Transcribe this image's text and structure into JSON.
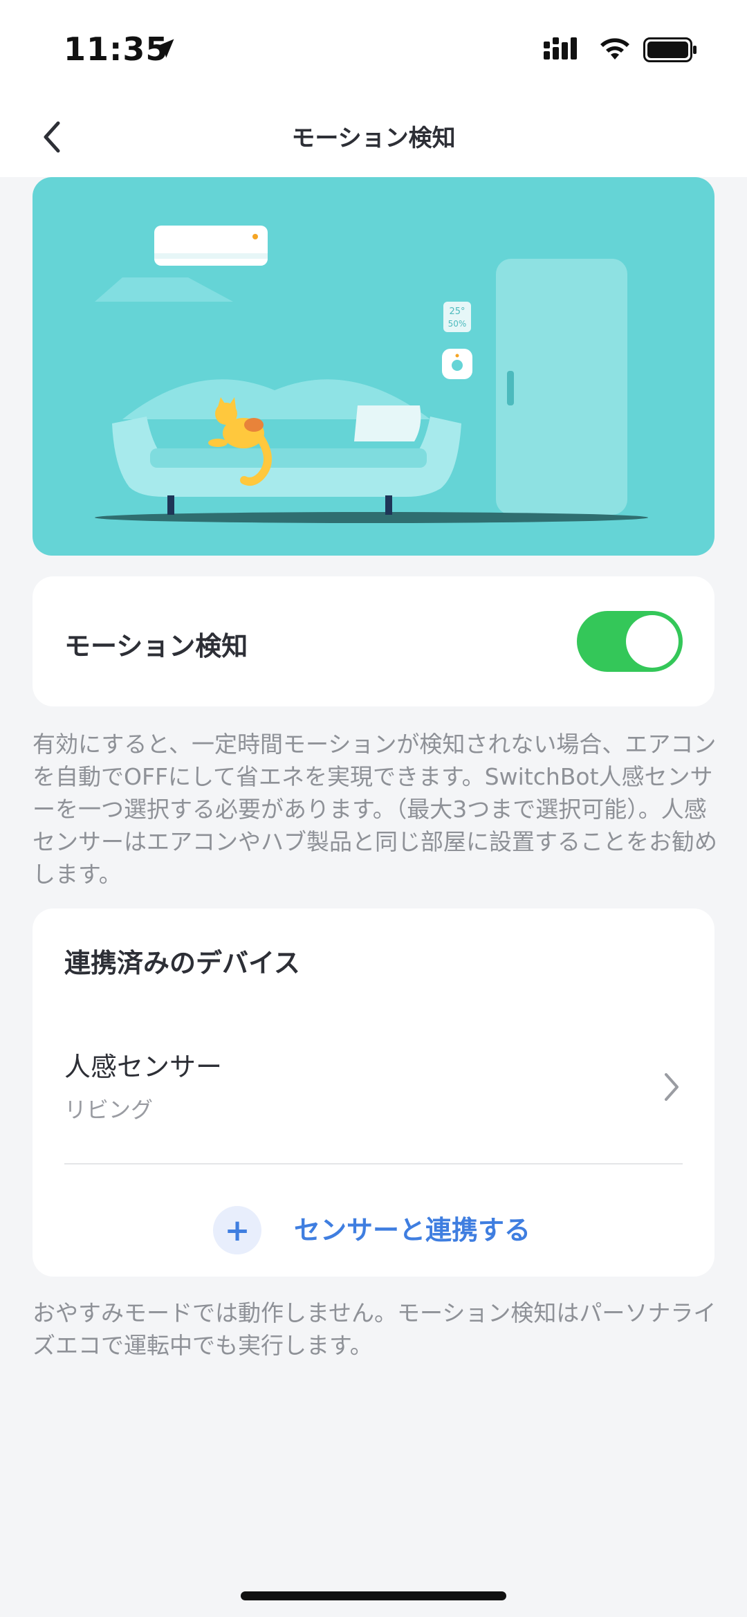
{
  "status_bar": {
    "time": "11:35",
    "icons": [
      "location-arrow-icon",
      "cellular-signal-icon",
      "wifi-icon",
      "battery-icon"
    ]
  },
  "nav": {
    "back_icon": "chevron-left-icon",
    "title": "モーション検知"
  },
  "hero": {
    "thermo_temp": "25°",
    "thermo_humidity": "50%"
  },
  "toggle": {
    "label": "モーション検知",
    "enabled": true,
    "on_color": "#34c759"
  },
  "description": "有効にすると、一定時間モーションが検知されない場合、エアコンを自動でOFFにして省エネを実現できます。SwitchBot人感センサーを一つ選択する必要があります。（最大3つまで選択可能）。人感センサーはエアコンやハブ製品と同じ部屋に設置することをお勧めします。",
  "linked_devices": {
    "title": "連携済みのデバイス",
    "items": [
      {
        "name": "人感センサー",
        "room": "リビング"
      }
    ],
    "add_label": "センサーと連携する",
    "add_icon": "plus-icon",
    "accent_color": "#3f7ee0"
  },
  "footer_note": "おやすみモードでは動作しません。モーション検知はパーソナライズエコで運転中でも実行します。"
}
